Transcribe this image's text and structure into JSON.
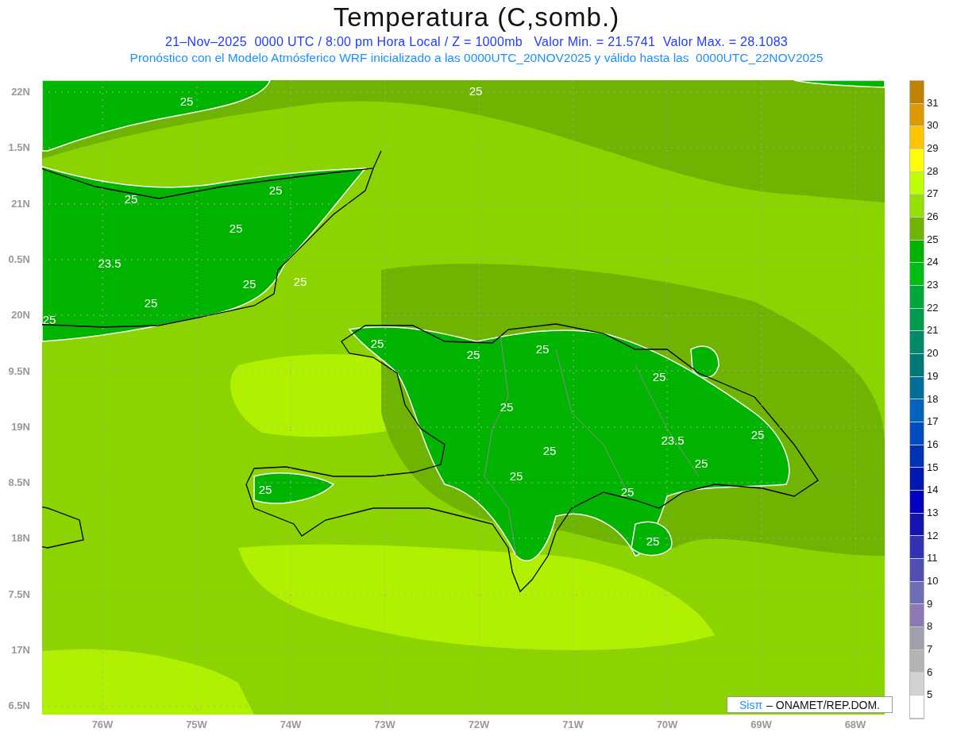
{
  "title": "Temperatura (C,somb.)",
  "subtitle": "21–Nov–2025  0000 UTC / 8:00 pm Hora Local / Z = 1000mb   Valor Min. = 21.5741  Valor Max. = 28.1083",
  "description": "Pronóstico con el Modelo Atmósferico WRF inicializado a las 0000UTC_20NOV2025 y válido hasta las  0000UTC_22NOV2025",
  "map": {
    "lat_labels": [
      "22N",
      "1.5N",
      "21N",
      "0.5N",
      "20N",
      "9.5N",
      "19N",
      "8.5N",
      "18N",
      "7.5N",
      "17N",
      "6.5N"
    ],
    "lon_labels": [
      "76W",
      "75W",
      "74W",
      "73W",
      "72W",
      "71W",
      "70W",
      "69W",
      "68W"
    ],
    "contour_labels": [
      "25",
      "25",
      "25",
      "25",
      "25",
      "23.5",
      "25",
      "25",
      "25",
      "25",
      "25",
      "25",
      "25",
      "25",
      "25",
      "23.5",
      "25",
      "25",
      "25",
      "25",
      "25",
      "25",
      "25"
    ]
  },
  "colorbar": {
    "steps": [
      {
        "color": "#c08000"
      },
      {
        "label": "31",
        "color": "#e09800"
      },
      {
        "label": "30",
        "color": "#ffc400"
      },
      {
        "label": "29",
        "color": "#ffff00"
      },
      {
        "label": "28",
        "color": "#c0ff00"
      },
      {
        "label": "27",
        "color": "#96e000"
      },
      {
        "label": "26",
        "color": "#6eb400"
      },
      {
        "label": "25",
        "color": "#00b400"
      },
      {
        "label": "24",
        "color": "#00be14"
      },
      {
        "label": "23",
        "color": "#00a83c"
      },
      {
        "label": "22",
        "color": "#009a50"
      },
      {
        "label": "21",
        "color": "#008a6a"
      },
      {
        "label": "20",
        "color": "#007878"
      },
      {
        "label": "19",
        "color": "#006e96"
      },
      {
        "label": "18",
        "color": "#0064be"
      },
      {
        "label": "17",
        "color": "#004cc0"
      },
      {
        "label": "16",
        "color": "#0032b4"
      },
      {
        "label": "15",
        "color": "#0018b4"
      },
      {
        "label": "14",
        "color": "#0000c0"
      },
      {
        "label": "13",
        "color": "#1414b4"
      },
      {
        "label": "12",
        "color": "#3232b4"
      },
      {
        "label": "11",
        "color": "#5050b4"
      },
      {
        "label": "10",
        "color": "#6e6eb4"
      },
      {
        "label": "9",
        "color": "#8c78b4"
      },
      {
        "label": "8",
        "color": "#a0a0aa"
      },
      {
        "label": "7",
        "color": "#b4b4b4"
      },
      {
        "label": "6",
        "color": "#d2d2d2"
      },
      {
        "label": "5",
        "color": "#ffffff"
      }
    ]
  },
  "credit": {
    "brand": "Sisπ",
    "text": "– ONAMET/REP.DOM."
  }
}
